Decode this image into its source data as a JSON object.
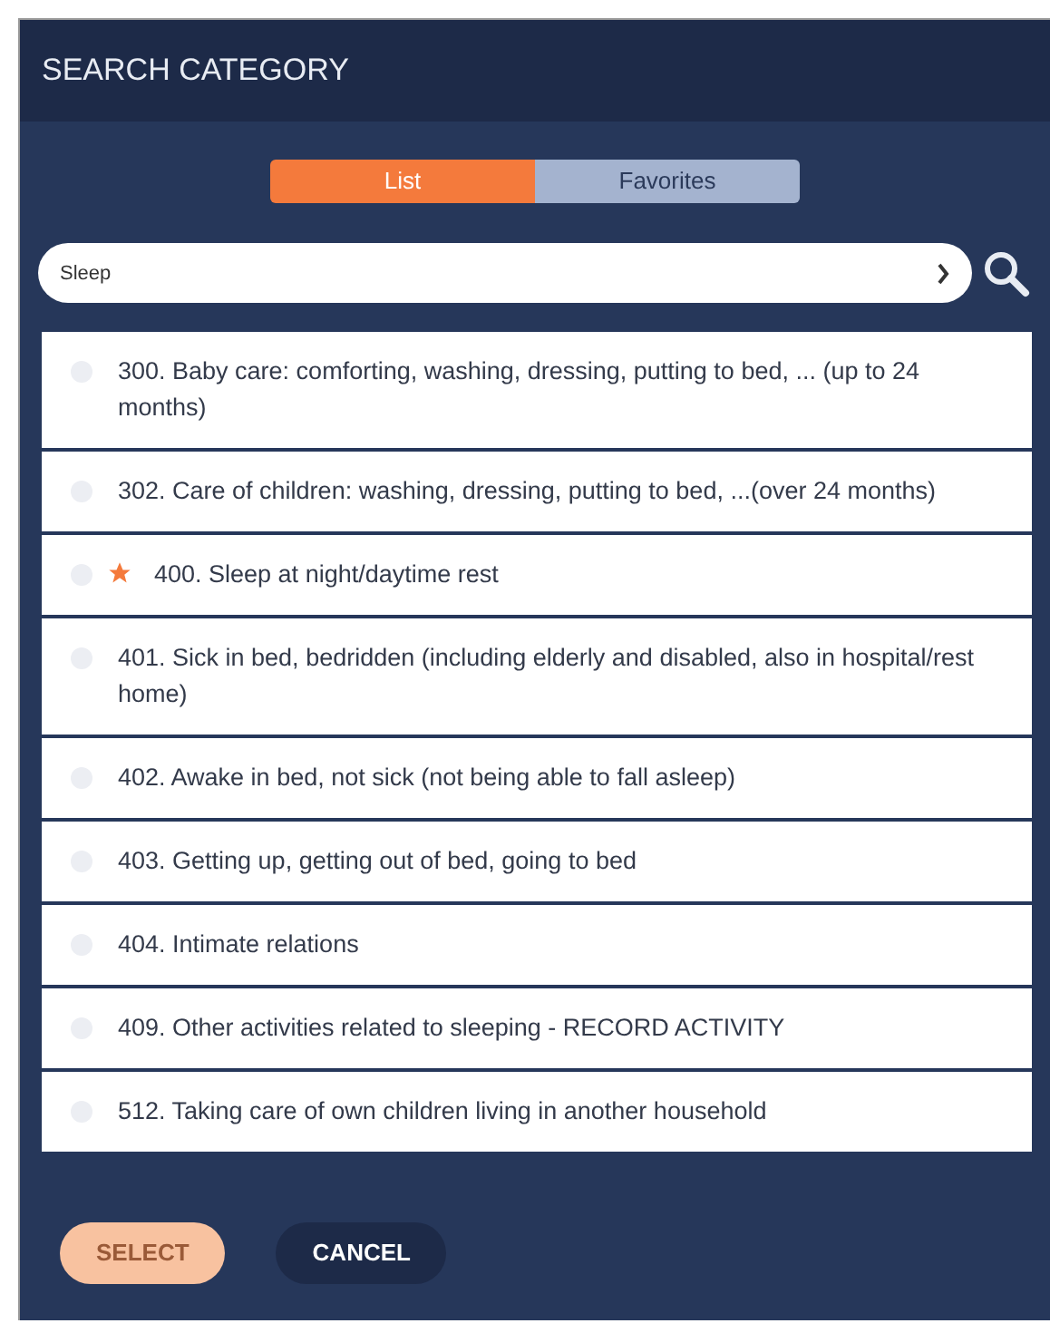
{
  "dialog": {
    "title": "SEARCH CATEGORY"
  },
  "tabs": [
    {
      "label": "List",
      "selected": true
    },
    {
      "label": "Favorites",
      "selected": false
    }
  ],
  "search": {
    "value": "Sleep"
  },
  "items": [
    {
      "label": "300. Baby care: comforting, washing, dressing, putting to bed, ... (up to 24 months)",
      "selected": false,
      "favorite": false
    },
    {
      "label": "302. Care of children: washing, dressing, putting to bed, ...(over 24 months)",
      "selected": false,
      "favorite": false
    },
    {
      "label": "400. Sleep at night/daytime rest",
      "selected": false,
      "favorite": true
    },
    {
      "label": "401. Sick in bed, bedridden (including elderly and disabled, also in hospital/rest home)",
      "selected": false,
      "favorite": false
    },
    {
      "label": "402. Awake in bed, not sick (not being able to fall asleep)",
      "selected": false,
      "favorite": false
    },
    {
      "label": "403. Getting up, getting out of bed, going to bed",
      "selected": false,
      "favorite": false
    },
    {
      "label": "404. Intimate relations",
      "selected": false,
      "favorite": false
    },
    {
      "label": "409. Other activities related to sleeping - RECORD ACTIVITY",
      "selected": false,
      "favorite": false
    },
    {
      "label": "512. Taking care of own children living in another household",
      "selected": false,
      "favorite": false
    }
  ],
  "buttons": [
    {
      "label": "SELECT",
      "kind": "primary",
      "disabled": true
    },
    {
      "label": "CANCEL",
      "kind": "secondary",
      "disabled": false
    }
  ]
}
